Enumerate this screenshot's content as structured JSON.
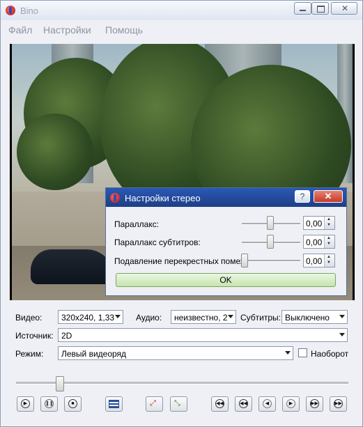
{
  "window": {
    "title": "Bino"
  },
  "menu": {
    "items": [
      "Файл",
      "Настройки",
      "Помощь"
    ]
  },
  "dialog": {
    "title": "Настройки стерео",
    "help_glyph": "?",
    "close_glyph": "✕",
    "rows": [
      {
        "label": "Параллакс:",
        "value": "0,00",
        "slider_pos": 0.5
      },
      {
        "label": "Параллакс субтитров:",
        "value": "0,00",
        "slider_pos": 0.5
      },
      {
        "label": "Подавление перекрестных помех:",
        "value": "0,00",
        "slider_pos": 0.0
      }
    ],
    "ok_label": "OK"
  },
  "controls": {
    "video_label": "Видео:",
    "video_value": "320x240, 1,33:",
    "audio_label": "Аудио:",
    "audio_value": "неизвестно, 2",
    "subtitles_label": "Субтитры:",
    "subtitles_value": "Выключено",
    "source_label": "Источник:",
    "source_value": "2D",
    "mode_label": "Режим:",
    "mode_value": "Левый видеоряд",
    "swap_label": "Наоборот",
    "swap_checked": false
  },
  "playback": {
    "position": 0.13
  },
  "icons": [
    "app-icon",
    "minimize-icon",
    "maximize-icon",
    "close-icon",
    "play-icon",
    "pause-icon",
    "stop-icon",
    "playlist-icon",
    "fullscreen-icon",
    "center-icon",
    "rewind-10min-icon",
    "rewind-1min-icon",
    "rewind-10s-icon",
    "forward-10s-icon",
    "forward-1min-icon",
    "forward-10min-icon"
  ]
}
